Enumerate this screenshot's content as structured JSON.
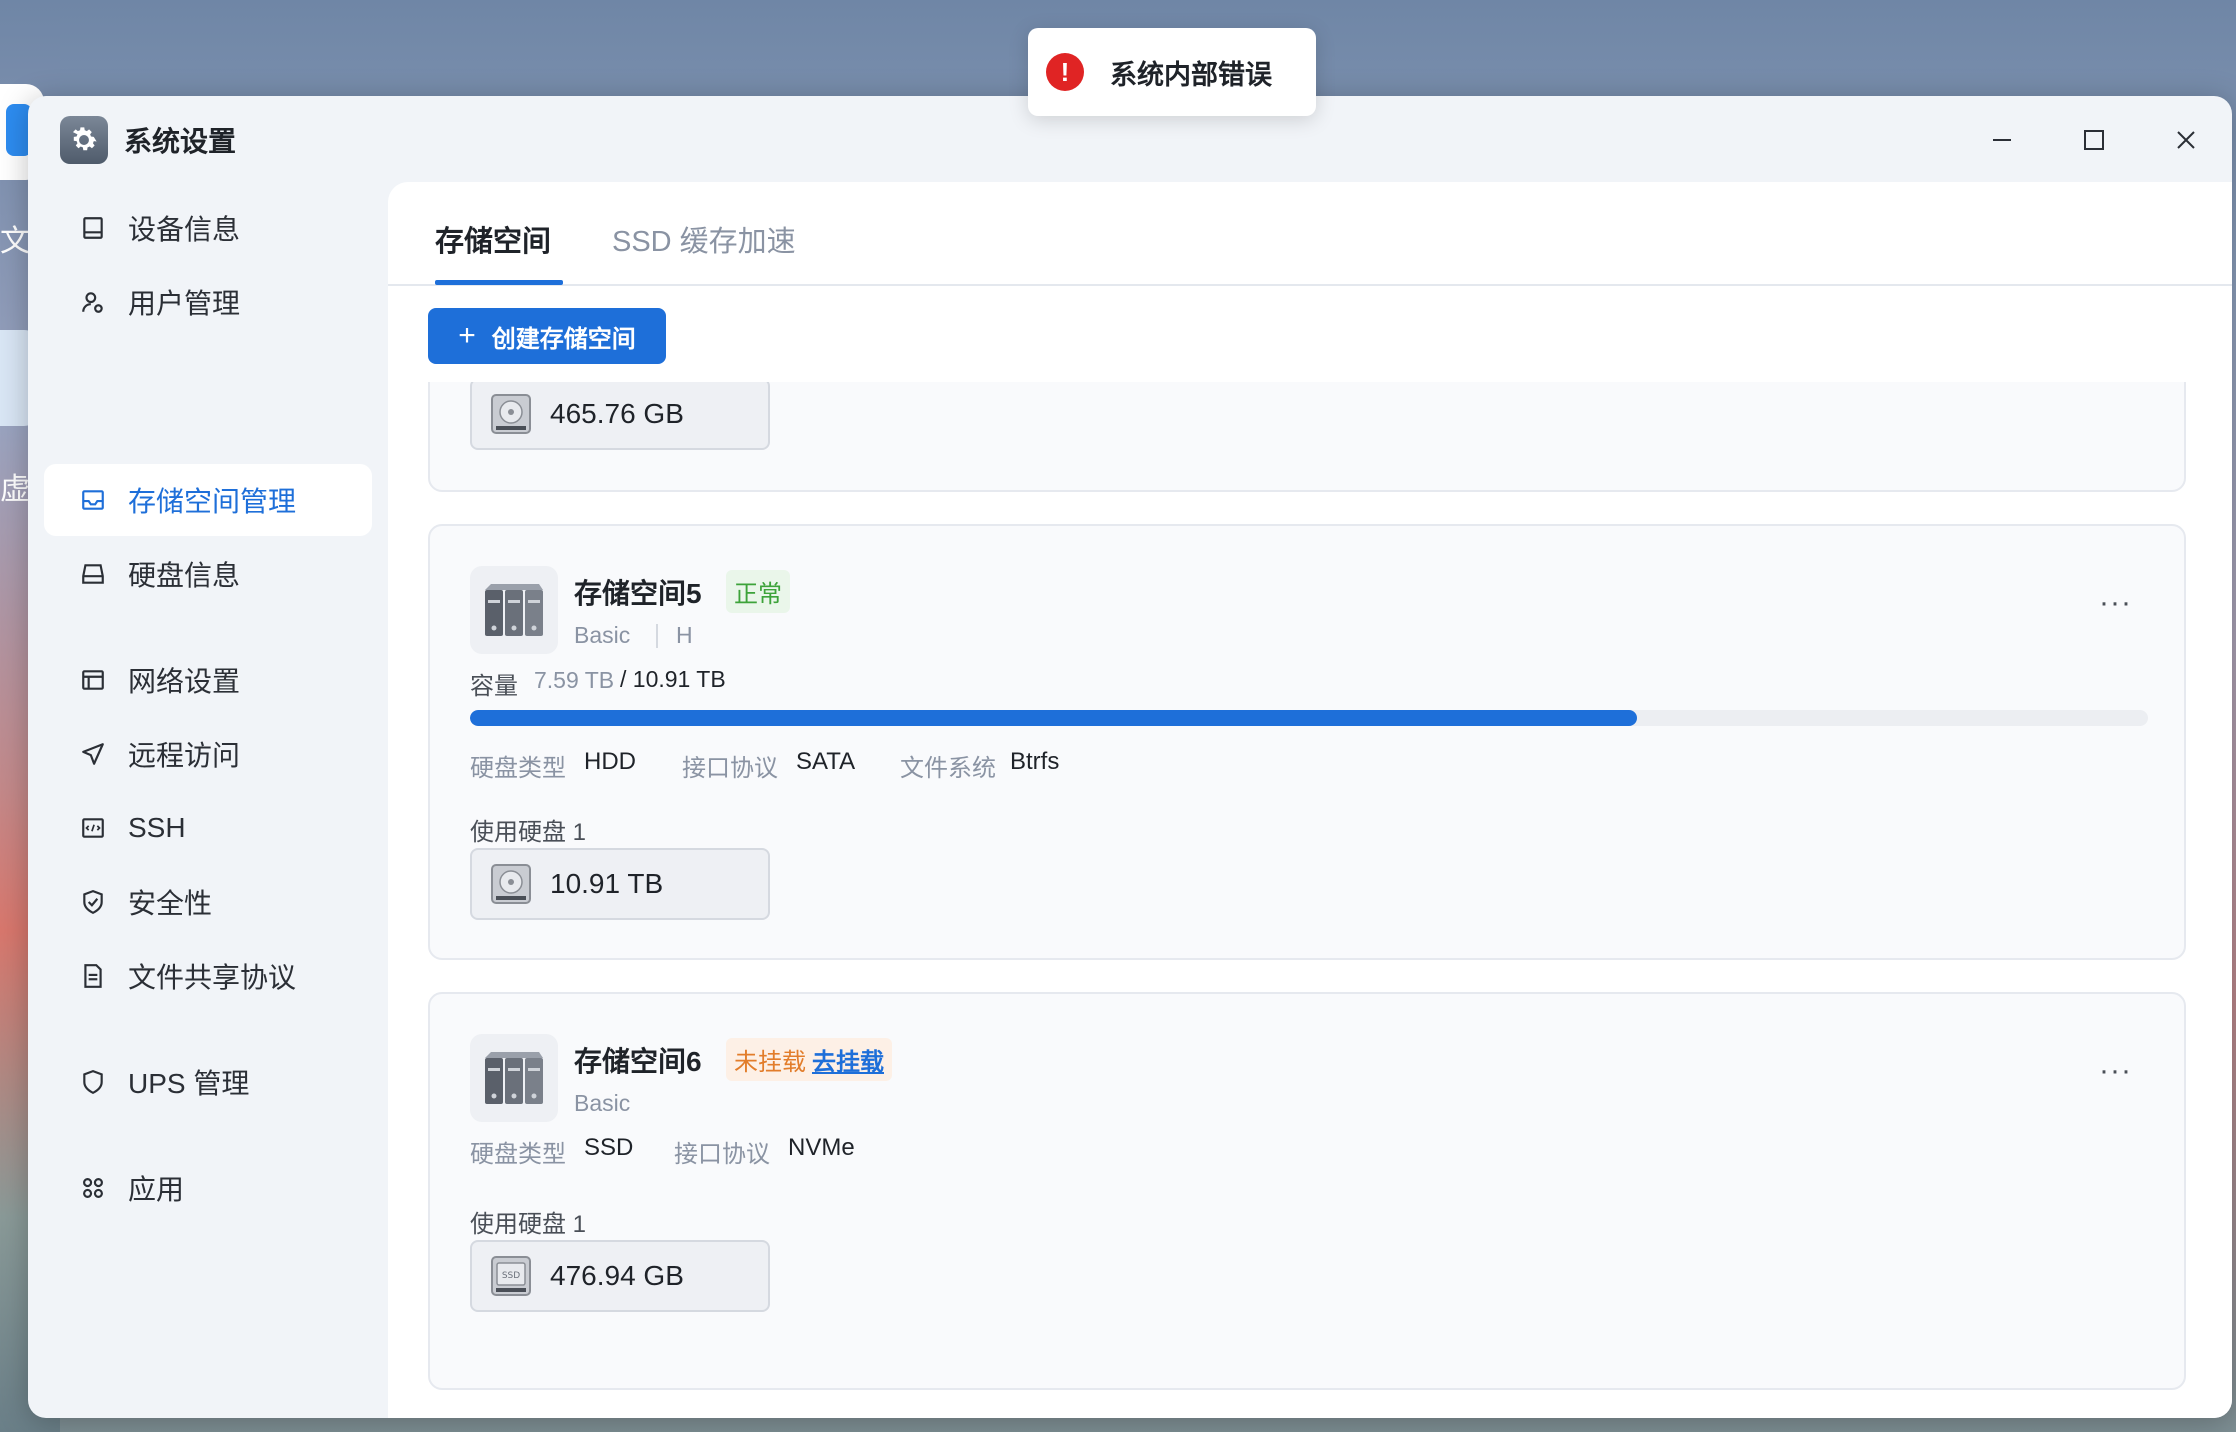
{
  "desktop": {
    "icon1_label": "文件",
    "icon2_label": "虚拟"
  },
  "toast": {
    "message": "系统内部错误"
  },
  "window": {
    "title": "系统设置"
  },
  "sidebar": {
    "items": [
      {
        "label": "设备信息",
        "icon": "device-icon"
      },
      {
        "label": "用户管理",
        "icon": "user-gear-icon"
      },
      {
        "label": "存储空间管理",
        "icon": "storage-icon",
        "active": true
      },
      {
        "label": "硬盘信息",
        "icon": "hdd-icon"
      },
      {
        "label": "网络设置",
        "icon": "network-icon"
      },
      {
        "label": "远程访问",
        "icon": "send-icon"
      },
      {
        "label": "SSH",
        "icon": "code-icon"
      },
      {
        "label": "安全性",
        "icon": "shield-check-icon"
      },
      {
        "label": "文件共享协议",
        "icon": "document-icon"
      },
      {
        "label": "UPS 管理",
        "icon": "shield-icon"
      },
      {
        "label": "应用",
        "icon": "apps-icon"
      }
    ]
  },
  "tabs": [
    {
      "label": "存储空间",
      "active": true
    },
    {
      "label": "SSD 缓存加速",
      "active": false
    }
  ],
  "toolbar": {
    "create_label": "创建存储空间"
  },
  "partial_card": {
    "disk_size": "465.76 GB"
  },
  "cards": [
    {
      "name": "存储空间5",
      "status": "正常",
      "raid": "Basic",
      "extra": "H",
      "capacity_label": "容量",
      "used": "7.59 TB",
      "total": "/ 10.91 TB",
      "used_fraction": 0.6957,
      "disk_type_label": "硬盘类型",
      "disk_type": "HDD",
      "protocol_label": "接口协议",
      "protocol": "SATA",
      "fs_label": "文件系统",
      "fs": "Btrfs",
      "disks_label": "使用硬盘 1",
      "disk_size": "10.91 TB",
      "more": "···"
    },
    {
      "name": "存储空间6",
      "status": "未挂载",
      "status_link": "去挂载",
      "raid": "Basic",
      "disk_type_label": "硬盘类型",
      "disk_type": "SSD",
      "protocol_label": "接口协议",
      "protocol": "NVMe",
      "disks_label": "使用硬盘 1",
      "disk_size": "476.94 GB",
      "more": "···"
    }
  ],
  "colors": {
    "accent": "#1e6fd9",
    "ok": "#3da33a",
    "warn": "#e27d2b",
    "error": "#e02424"
  }
}
